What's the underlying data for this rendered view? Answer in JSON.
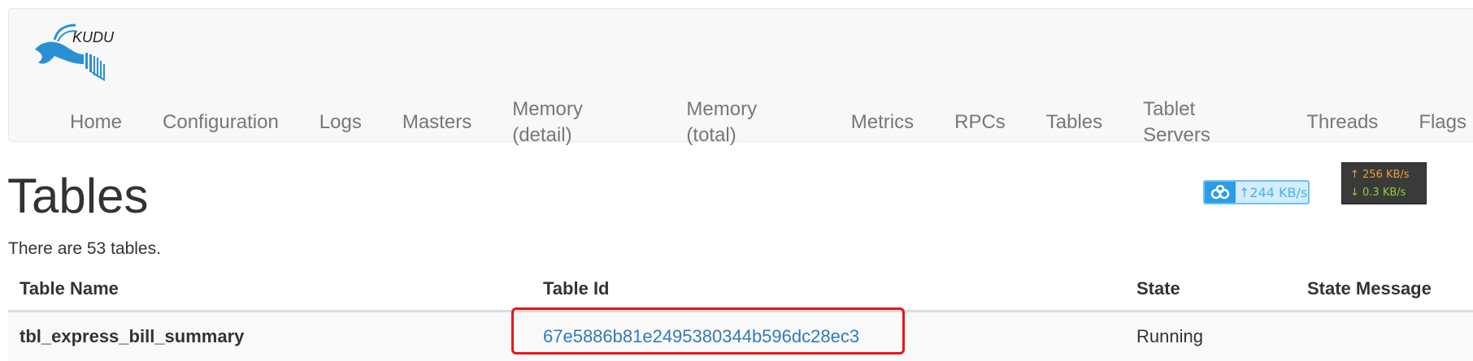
{
  "brand": {
    "logo_text": "KUDU",
    "logo_color": "#2a90d4"
  },
  "nav": {
    "items": [
      {
        "label": "Home"
      },
      {
        "label": "Configuration"
      },
      {
        "label": "Logs"
      },
      {
        "label": "Masters"
      },
      {
        "label": "Memory (detail)"
      },
      {
        "label": "Memory (total)"
      },
      {
        "label": "Metrics"
      },
      {
        "label": "RPCs"
      },
      {
        "label": "Tables"
      },
      {
        "label": "Tablet Servers"
      },
      {
        "label": "Threads"
      },
      {
        "label": "Flags"
      }
    ]
  },
  "page": {
    "title": "Tables",
    "summary": "There are 53 tables."
  },
  "net_widget": {
    "icon": "cloud-icon",
    "rate": "↑244 KB/s"
  },
  "speed_box": {
    "upload": "↑ 256 KB/s",
    "download": "↓ 0.3 KB/s",
    "upload_color": "#e8a23c",
    "download_color": "#8fd13a"
  },
  "table": {
    "headers": [
      "Table Name",
      "Table Id",
      "State",
      "State Message"
    ],
    "rows": [
      {
        "name": "tbl_express_bill_summary",
        "id": "67e5886b81e2495380344b596dc28ec3",
        "state": "Running",
        "message": ""
      }
    ]
  },
  "colors": {
    "link": "#337ab7",
    "highlight": "#e8151b",
    "nav_text": "#777777"
  }
}
